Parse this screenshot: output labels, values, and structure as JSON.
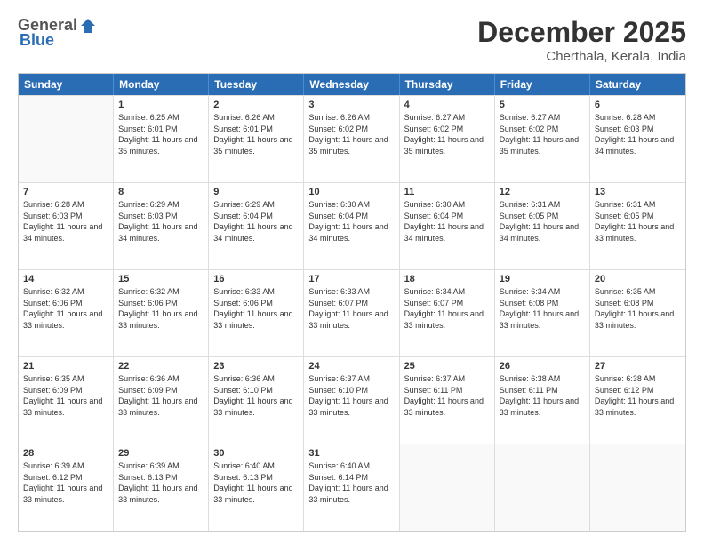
{
  "logo": {
    "general": "General",
    "blue": "Blue"
  },
  "header": {
    "title": "December 2025",
    "subtitle": "Cherthala, Kerala, India"
  },
  "days": [
    "Sunday",
    "Monday",
    "Tuesday",
    "Wednesday",
    "Thursday",
    "Friday",
    "Saturday"
  ],
  "weeks": [
    [
      {
        "day": "",
        "empty": true
      },
      {
        "day": "1",
        "sunrise": "Sunrise: 6:25 AM",
        "sunset": "Sunset: 6:01 PM",
        "daylight": "Daylight: 11 hours and 35 minutes."
      },
      {
        "day": "2",
        "sunrise": "Sunrise: 6:26 AM",
        "sunset": "Sunset: 6:01 PM",
        "daylight": "Daylight: 11 hours and 35 minutes."
      },
      {
        "day": "3",
        "sunrise": "Sunrise: 6:26 AM",
        "sunset": "Sunset: 6:02 PM",
        "daylight": "Daylight: 11 hours and 35 minutes."
      },
      {
        "day": "4",
        "sunrise": "Sunrise: 6:27 AM",
        "sunset": "Sunset: 6:02 PM",
        "daylight": "Daylight: 11 hours and 35 minutes."
      },
      {
        "day": "5",
        "sunrise": "Sunrise: 6:27 AM",
        "sunset": "Sunset: 6:02 PM",
        "daylight": "Daylight: 11 hours and 35 minutes."
      },
      {
        "day": "6",
        "sunrise": "Sunrise: 6:28 AM",
        "sunset": "Sunset: 6:03 PM",
        "daylight": "Daylight: 11 hours and 34 minutes."
      }
    ],
    [
      {
        "day": "7",
        "sunrise": "Sunrise: 6:28 AM",
        "sunset": "Sunset: 6:03 PM",
        "daylight": "Daylight: 11 hours and 34 minutes."
      },
      {
        "day": "8",
        "sunrise": "Sunrise: 6:29 AM",
        "sunset": "Sunset: 6:03 PM",
        "daylight": "Daylight: 11 hours and 34 minutes."
      },
      {
        "day": "9",
        "sunrise": "Sunrise: 6:29 AM",
        "sunset": "Sunset: 6:04 PM",
        "daylight": "Daylight: 11 hours and 34 minutes."
      },
      {
        "day": "10",
        "sunrise": "Sunrise: 6:30 AM",
        "sunset": "Sunset: 6:04 PM",
        "daylight": "Daylight: 11 hours and 34 minutes."
      },
      {
        "day": "11",
        "sunrise": "Sunrise: 6:30 AM",
        "sunset": "Sunset: 6:04 PM",
        "daylight": "Daylight: 11 hours and 34 minutes."
      },
      {
        "day": "12",
        "sunrise": "Sunrise: 6:31 AM",
        "sunset": "Sunset: 6:05 PM",
        "daylight": "Daylight: 11 hours and 34 minutes."
      },
      {
        "day": "13",
        "sunrise": "Sunrise: 6:31 AM",
        "sunset": "Sunset: 6:05 PM",
        "daylight": "Daylight: 11 hours and 33 minutes."
      }
    ],
    [
      {
        "day": "14",
        "sunrise": "Sunrise: 6:32 AM",
        "sunset": "Sunset: 6:06 PM",
        "daylight": "Daylight: 11 hours and 33 minutes."
      },
      {
        "day": "15",
        "sunrise": "Sunrise: 6:32 AM",
        "sunset": "Sunset: 6:06 PM",
        "daylight": "Daylight: 11 hours and 33 minutes."
      },
      {
        "day": "16",
        "sunrise": "Sunrise: 6:33 AM",
        "sunset": "Sunset: 6:06 PM",
        "daylight": "Daylight: 11 hours and 33 minutes."
      },
      {
        "day": "17",
        "sunrise": "Sunrise: 6:33 AM",
        "sunset": "Sunset: 6:07 PM",
        "daylight": "Daylight: 11 hours and 33 minutes."
      },
      {
        "day": "18",
        "sunrise": "Sunrise: 6:34 AM",
        "sunset": "Sunset: 6:07 PM",
        "daylight": "Daylight: 11 hours and 33 minutes."
      },
      {
        "day": "19",
        "sunrise": "Sunrise: 6:34 AM",
        "sunset": "Sunset: 6:08 PM",
        "daylight": "Daylight: 11 hours and 33 minutes."
      },
      {
        "day": "20",
        "sunrise": "Sunrise: 6:35 AM",
        "sunset": "Sunset: 6:08 PM",
        "daylight": "Daylight: 11 hours and 33 minutes."
      }
    ],
    [
      {
        "day": "21",
        "sunrise": "Sunrise: 6:35 AM",
        "sunset": "Sunset: 6:09 PM",
        "daylight": "Daylight: 11 hours and 33 minutes."
      },
      {
        "day": "22",
        "sunrise": "Sunrise: 6:36 AM",
        "sunset": "Sunset: 6:09 PM",
        "daylight": "Daylight: 11 hours and 33 minutes."
      },
      {
        "day": "23",
        "sunrise": "Sunrise: 6:36 AM",
        "sunset": "Sunset: 6:10 PM",
        "daylight": "Daylight: 11 hours and 33 minutes."
      },
      {
        "day": "24",
        "sunrise": "Sunrise: 6:37 AM",
        "sunset": "Sunset: 6:10 PM",
        "daylight": "Daylight: 11 hours and 33 minutes."
      },
      {
        "day": "25",
        "sunrise": "Sunrise: 6:37 AM",
        "sunset": "Sunset: 6:11 PM",
        "daylight": "Daylight: 11 hours and 33 minutes."
      },
      {
        "day": "26",
        "sunrise": "Sunrise: 6:38 AM",
        "sunset": "Sunset: 6:11 PM",
        "daylight": "Daylight: 11 hours and 33 minutes."
      },
      {
        "day": "27",
        "sunrise": "Sunrise: 6:38 AM",
        "sunset": "Sunset: 6:12 PM",
        "daylight": "Daylight: 11 hours and 33 minutes."
      }
    ],
    [
      {
        "day": "28",
        "sunrise": "Sunrise: 6:39 AM",
        "sunset": "Sunset: 6:12 PM",
        "daylight": "Daylight: 11 hours and 33 minutes."
      },
      {
        "day": "29",
        "sunrise": "Sunrise: 6:39 AM",
        "sunset": "Sunset: 6:13 PM",
        "daylight": "Daylight: 11 hours and 33 minutes."
      },
      {
        "day": "30",
        "sunrise": "Sunrise: 6:40 AM",
        "sunset": "Sunset: 6:13 PM",
        "daylight": "Daylight: 11 hours and 33 minutes."
      },
      {
        "day": "31",
        "sunrise": "Sunrise: 6:40 AM",
        "sunset": "Sunset: 6:14 PM",
        "daylight": "Daylight: 11 hours and 33 minutes."
      },
      {
        "day": "",
        "empty": true
      },
      {
        "day": "",
        "empty": true
      },
      {
        "day": "",
        "empty": true
      }
    ]
  ]
}
